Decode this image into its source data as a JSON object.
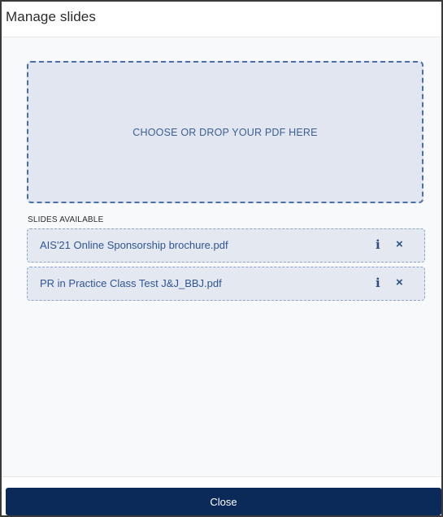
{
  "modal": {
    "title": "Manage slides"
  },
  "dropzone": {
    "label": "CHOOSE OR DROP YOUR PDF HERE"
  },
  "slides": {
    "section_label": "SLIDES AVAILABLE",
    "items": [
      {
        "name": "AIS'21 Online Sponsorship brochure.pdf",
        "info_icon": "i",
        "delete_icon": "×"
      },
      {
        "name": "PR in Practice Class Test J&J_BBJ.pdf",
        "info_icon": "i",
        "delete_icon": "×"
      }
    ]
  },
  "footer": {
    "close_label": "Close"
  },
  "colors": {
    "accent": "#0b2a5a",
    "dropzone_border": "#4a6fa8",
    "item_text": "#2f5593"
  },
  "icons": {
    "info": "info-icon",
    "delete": "close-icon"
  }
}
